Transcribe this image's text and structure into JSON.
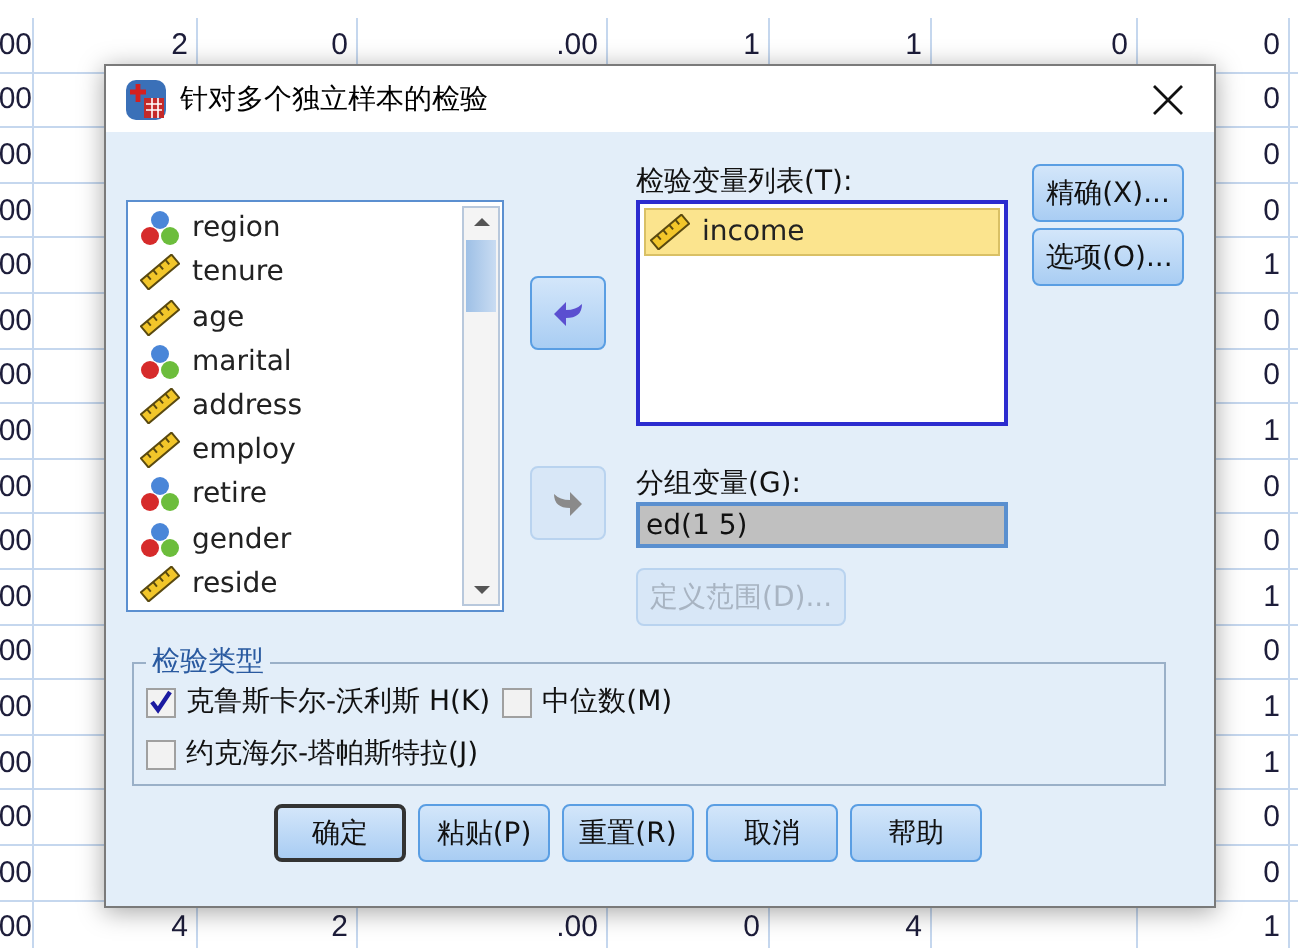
{
  "data_grid": {
    "rows": [
      [
        "00",
        "2",
        "0",
        ".00",
        "1",
        "1",
        "0",
        "0"
      ],
      [
        "00",
        null,
        null,
        null,
        null,
        null,
        null,
        "0"
      ],
      [
        "00",
        null,
        null,
        null,
        null,
        null,
        null,
        "0"
      ],
      [
        "00",
        null,
        null,
        null,
        null,
        null,
        null,
        "0"
      ],
      [
        "00",
        null,
        null,
        null,
        null,
        null,
        null,
        "1"
      ],
      [
        "00",
        null,
        null,
        null,
        null,
        null,
        null,
        "0"
      ],
      [
        "00",
        null,
        null,
        null,
        null,
        null,
        null,
        "0"
      ],
      [
        "00",
        null,
        null,
        null,
        null,
        null,
        null,
        "1"
      ],
      [
        "00",
        null,
        null,
        null,
        null,
        null,
        null,
        "0"
      ],
      [
        "00",
        null,
        null,
        null,
        null,
        null,
        null,
        "0"
      ],
      [
        "00",
        null,
        null,
        null,
        null,
        null,
        null,
        "1"
      ],
      [
        "00",
        null,
        null,
        null,
        null,
        null,
        null,
        "0"
      ],
      [
        "00",
        null,
        null,
        null,
        null,
        null,
        null,
        "1"
      ],
      [
        "00",
        null,
        null,
        null,
        null,
        null,
        null,
        "1"
      ],
      [
        "00",
        null,
        null,
        null,
        null,
        null,
        null,
        "0"
      ],
      [
        "00",
        null,
        null,
        null,
        null,
        null,
        null,
        "0"
      ],
      [
        "00",
        "4",
        "2",
        ".00",
        "0",
        "4",
        null,
        "1"
      ]
    ]
  },
  "dialog": {
    "title": "针对多个独立样本的检验",
    "source_list": {
      "items": [
        {
          "label": "region",
          "kind": "nominal"
        },
        {
          "label": "tenure",
          "kind": "scale"
        },
        {
          "label": "age",
          "kind": "scale"
        },
        {
          "label": "marital",
          "kind": "nominal"
        },
        {
          "label": "address",
          "kind": "scale"
        },
        {
          "label": "employ",
          "kind": "scale"
        },
        {
          "label": "retire",
          "kind": "nominal"
        },
        {
          "label": "gender",
          "kind": "nominal"
        },
        {
          "label": "reside",
          "kind": "scale"
        }
      ]
    },
    "move_buttons": [
      {
        "kind": "left",
        "disabled": false
      },
      {
        "kind": "right",
        "disabled": true
      }
    ],
    "test_variables": {
      "label": "检验变量列表(T):",
      "items": [
        {
          "label": "income",
          "kind": "scale",
          "selected": true
        }
      ]
    },
    "grouping": {
      "label": "分组变量(G):",
      "value": "ed(1 5)",
      "define_range": {
        "label": "定义范围(D)...",
        "disabled": true
      }
    },
    "side_buttons": [
      {
        "label": "精确(X)..."
      },
      {
        "label": "选项(O)..."
      }
    ],
    "test_type": {
      "title": "检验类型",
      "options": [
        {
          "label": "克鲁斯卡尔-沃利斯 H(K)",
          "checked": true
        },
        {
          "label": "中位数(M)",
          "checked": false
        },
        {
          "label": "约克海尔-塔帕斯特拉(J)",
          "checked": false
        }
      ]
    },
    "buttons": [
      {
        "label": "确定",
        "default": true
      },
      {
        "label": "粘贴(P)",
        "default": false
      },
      {
        "label": "重置(R)",
        "default": false
      },
      {
        "label": "取消",
        "default": false
      },
      {
        "label": "帮助",
        "default": false
      }
    ]
  }
}
